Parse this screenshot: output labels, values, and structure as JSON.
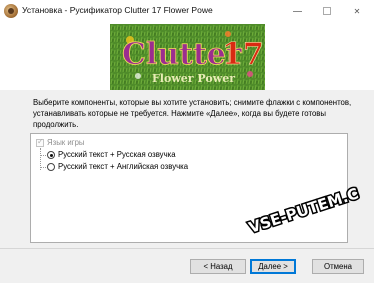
{
  "window": {
    "title": "Установка - Русификатор Clutter 17 Flower Powe",
    "close_glyph": "✕"
  },
  "banner": {
    "logo_line1": "Clutter",
    "logo_number": "17",
    "logo_line2": "Flower Power",
    "bg_color": "#4f8c2a",
    "text_color": "#e8ecb6",
    "number_color": "#d92a12"
  },
  "instructions": "Выберите компоненты, которые вы хотите установить; снимите флажки с компонентов, устанавливать которые не требуется. Нажмите «Далее», когда вы будете готовы продолжить.",
  "components": {
    "group_label": "Язык игры",
    "options": [
      {
        "label": "Русский текст + Русская озвучка",
        "selected": true
      },
      {
        "label": "Русский текст + Английская озвучка",
        "selected": false
      }
    ]
  },
  "watermark": "VSE-PUTEM.COM",
  "buttons": {
    "back": "< Назад",
    "next": "Далее >",
    "cancel": "Отмена"
  }
}
